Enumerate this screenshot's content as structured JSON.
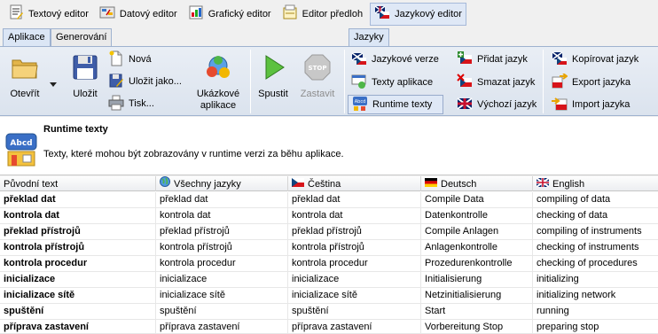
{
  "editor_tabs": [
    {
      "label": "Textový editor",
      "icon": "text-editor-icon"
    },
    {
      "label": "Datový editor",
      "icon": "data-editor-icon"
    },
    {
      "label": "Grafický editor",
      "icon": "graphic-editor-icon"
    },
    {
      "label": "Editor předloh",
      "icon": "template-editor-icon"
    },
    {
      "label": "Jazykový editor",
      "icon": "language-editor-icon",
      "active": true
    }
  ],
  "ribbon_tabs": {
    "left": [
      "Aplikace",
      "Generování"
    ],
    "right": "Jazyky"
  },
  "ribbon": {
    "open": "Otevřít",
    "save": "Uložit",
    "new": "Nová",
    "save_as": "Uložit jako...",
    "print": "Tisk...",
    "sample_apps_line1": "Ukázkové",
    "sample_apps_line2": "aplikace",
    "run": "Spustit",
    "stop": "Zastavit",
    "language_versions": "Jazykové verze",
    "app_texts": "Texty aplikace",
    "runtime_texts": "Runtime texty",
    "add_language": "Přidat jazyk",
    "delete_language": "Smazat jazyk",
    "default_language": "Výchozí jazyk",
    "copy_language": "Kopírovat jazyk",
    "export_language": "Export jazyka",
    "import_language": "Import jazyka"
  },
  "info": {
    "title": "Runtime texty",
    "description": "Texty, které mohou být zobrazovány v runtime verzi za běhu aplikace."
  },
  "grid": {
    "columns": [
      "Původní text",
      "Všechny jazyky",
      "Čeština",
      "Deutsch",
      "English"
    ],
    "rows": [
      [
        "překlad dat",
        "překlad dat",
        "překlad dat",
        "Compile Data",
        "compiling of data"
      ],
      [
        "kontrola dat",
        "kontrola dat",
        "kontrola dat",
        "Datenkontrolle",
        "checking of data"
      ],
      [
        "překlad přístrojů",
        "překlad přístrojů",
        "překlad přístrojů",
        "Compile Anlagen",
        "compiling of instruments"
      ],
      [
        "kontrola přístrojů",
        "kontrola přístrojů",
        "kontrola přístrojů",
        "Anlagenkontrolle",
        "checking of instruments"
      ],
      [
        "kontrola procedur",
        "kontrola procedur",
        "kontrola procedur",
        "Prozedurenkontrolle",
        "checking of procedures"
      ],
      [
        "inicializace",
        "inicializace",
        "inicializace",
        "Initialisierung",
        "initializing"
      ],
      [
        "inicializace sítě",
        "inicializace sítě",
        "inicializace sítě",
        "Netzinitialisierung",
        "initializing network"
      ],
      [
        "spuštění",
        "spuštění",
        "spuštění",
        "Start",
        "running"
      ],
      [
        "příprava zastavení",
        "příprava zastavení",
        "příprava zastavení",
        "Vorbereitung Stop",
        "preparing stop"
      ]
    ]
  }
}
